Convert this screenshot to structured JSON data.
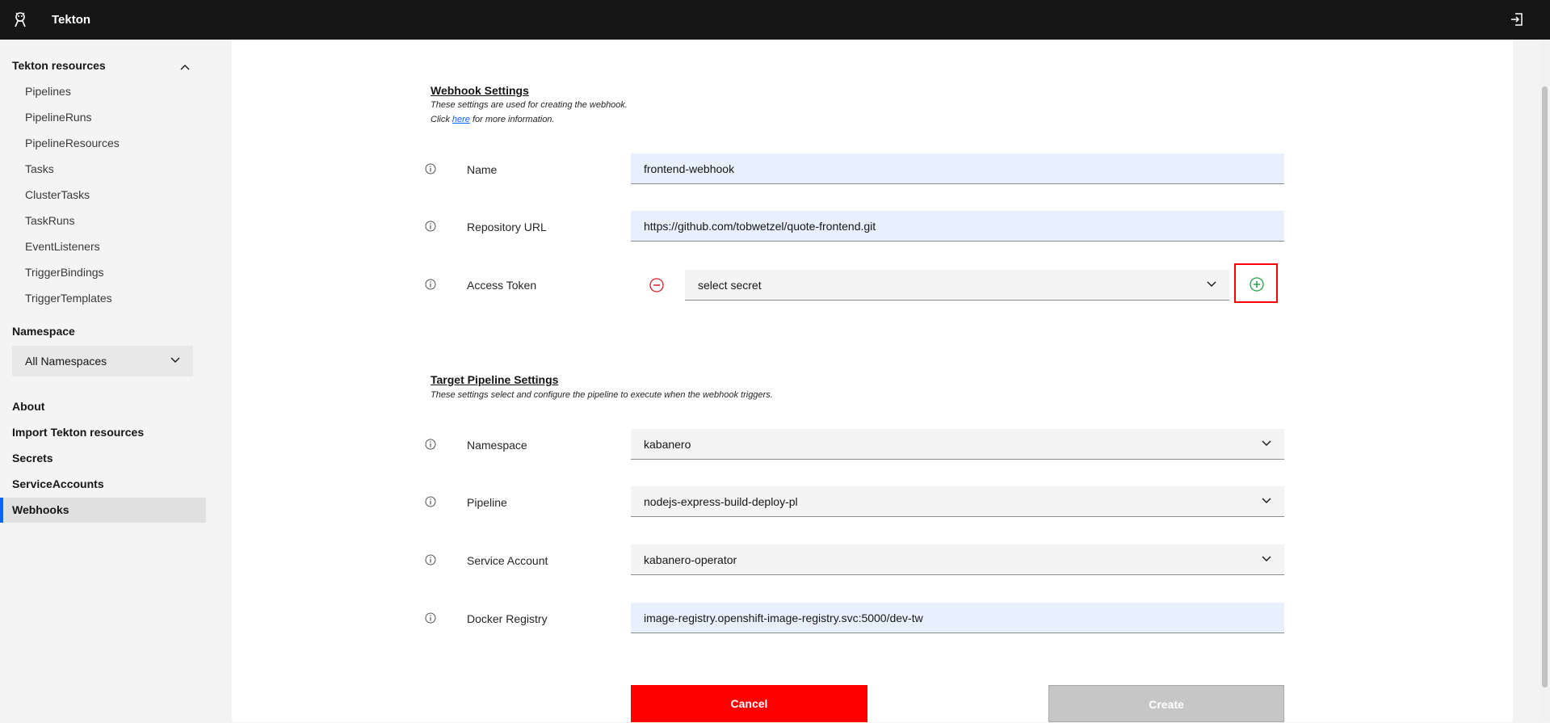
{
  "app": {
    "title": "Tekton"
  },
  "sidebar": {
    "section_title": "Tekton resources",
    "resources": [
      {
        "label": "Pipelines"
      },
      {
        "label": "PipelineRuns"
      },
      {
        "label": "PipelineResources"
      },
      {
        "label": "Tasks"
      },
      {
        "label": "ClusterTasks"
      },
      {
        "label": "TaskRuns"
      },
      {
        "label": "EventListeners"
      },
      {
        "label": "TriggerBindings"
      },
      {
        "label": "TriggerTemplates"
      }
    ],
    "namespace_label": "Namespace",
    "namespace_value": "All Namespaces",
    "links": [
      {
        "label": "About"
      },
      {
        "label": "Import Tekton resources"
      },
      {
        "label": "Secrets"
      },
      {
        "label": "ServiceAccounts"
      },
      {
        "label": "Webhooks"
      }
    ],
    "active_link": "Webhooks"
  },
  "webhook_settings": {
    "title": "Webhook Settings",
    "desc_line1": "These settings are used for creating the webhook.",
    "desc_click": "Click",
    "desc_link": "here",
    "desc_after": "for more information.",
    "fields": {
      "name": {
        "label": "Name",
        "value": "frontend-webhook"
      },
      "repo": {
        "label": "Repository URL",
        "value": "https://github.com/tobwetzel/quote-frontend.git"
      },
      "token": {
        "label": "Access Token",
        "value": "select secret"
      }
    }
  },
  "target_settings": {
    "title": "Target Pipeline Settings",
    "desc": "These settings select and configure the pipeline to execute when the webhook triggers.",
    "fields": {
      "namespace": {
        "label": "Namespace",
        "value": "kabanero"
      },
      "pipeline": {
        "label": "Pipeline",
        "value": "nodejs-express-build-deploy-pl"
      },
      "service_account": {
        "label": "Service Account",
        "value": "kabanero-operator"
      },
      "docker_registry": {
        "label": "Docker Registry",
        "value": "image-registry.openshift-image-registry.svc:5000/dev-tw"
      }
    }
  },
  "buttons": {
    "cancel": "Cancel",
    "create": "Create"
  },
  "colors": {
    "accent": "#0f62fe",
    "cancel": "#ff0000",
    "remove": "#da1e28",
    "add": "#24a148",
    "highlight": "#ff0000"
  }
}
